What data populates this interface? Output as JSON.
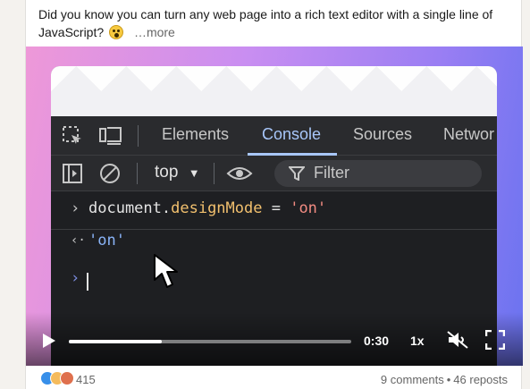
{
  "post": {
    "text": "Did you know you can turn any web page into a rich text editor with a single line of JavaScript?",
    "emoji": "astonished-face-emoji",
    "more_label": "…more"
  },
  "devtools": {
    "tabs": [
      {
        "label": "Elements",
        "active": false
      },
      {
        "label": "Console",
        "active": true
      },
      {
        "label": "Sources",
        "active": false
      },
      {
        "label": "Networ",
        "active": false
      }
    ],
    "context": "top",
    "filter_placeholder": "Filter",
    "console": {
      "line1_prefix": "document.",
      "line1_prop": "designMode",
      "line1_op": " = ",
      "line1_value": "'on'",
      "result": "'on'"
    }
  },
  "player": {
    "time": "0:30",
    "speed": "1x",
    "progress": 0.33
  },
  "social": {
    "reaction_count": "415",
    "comments": "9 comments",
    "separator": "•",
    "reposts": "46 reposts"
  },
  "colors": {
    "accent_tab": "#a8c7fa",
    "prop": "#f2c06e",
    "string": "#f28b82"
  }
}
